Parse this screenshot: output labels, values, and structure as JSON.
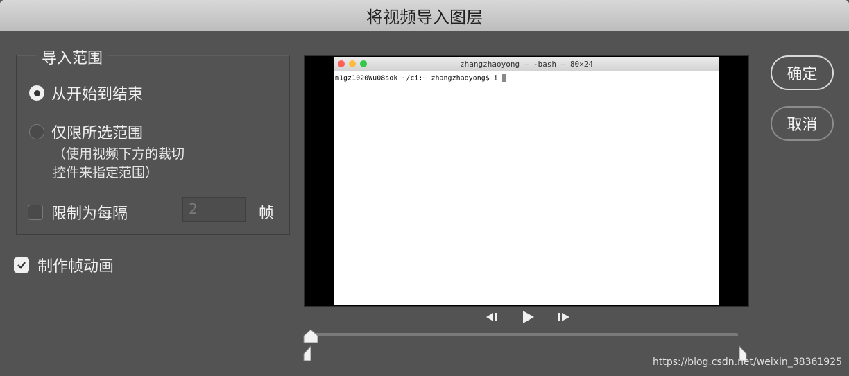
{
  "dialog": {
    "title": "将视频导入图层"
  },
  "range_group": {
    "title": "导入范围",
    "option_all": "从开始到结束",
    "option_selected": "仅限所选范围",
    "option_selected_hint_line1": "（使用视频下方的裁切",
    "option_selected_hint_line2": "控件来指定范围）",
    "selected_option": "从开始到结束",
    "limit_label": "限制为每隔",
    "limit_value": "2",
    "limit_checked": false,
    "limit_unit": "帧"
  },
  "make_frame_animation": {
    "label": "制作帧动画",
    "checked": true
  },
  "preview": {
    "terminal_title": "zhangzhaoyong — -bash — 80×24",
    "terminal_prompt": "m1gz1020Wu08sok ~/ci:~ zhangzhaoyong$ i",
    "traffic_colors": [
      "#fc605b",
      "#fdbc40",
      "#34c84a"
    ]
  },
  "playback": {
    "prev_frame_icon": "step-back-icon",
    "play_icon": "play-icon",
    "next_frame_icon": "step-forward-icon"
  },
  "buttons": {
    "ok": "确定",
    "cancel": "取消"
  },
  "watermark": "https://blog.csdn.net/weixin_38361925"
}
